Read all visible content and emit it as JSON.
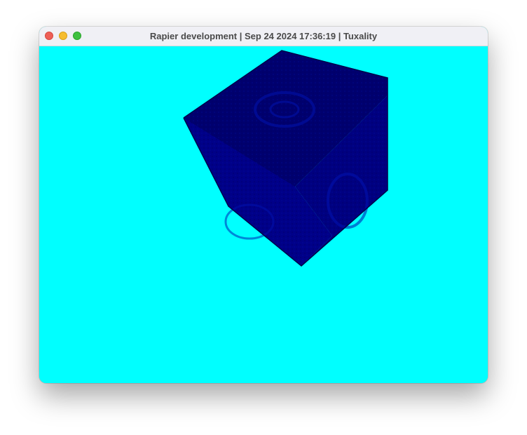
{
  "window": {
    "title": "Rapier development | Sep 24 2024 17:36:19 | Tuxality"
  },
  "colors": {
    "background": "#00ffff",
    "cube_face_top": "#00006e",
    "cube_face_left": "#000088",
    "cube_face_right": "#000080"
  },
  "scene": {
    "object": "textured-cube"
  }
}
